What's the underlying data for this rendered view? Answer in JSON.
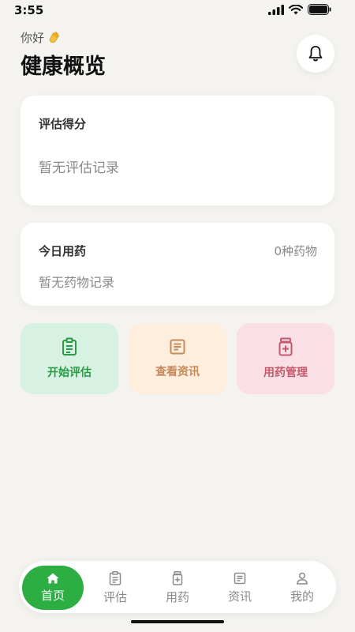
{
  "status_bar": {
    "time": "3:55"
  },
  "header": {
    "greeting": "你好",
    "title": "健康概览"
  },
  "score_card": {
    "title": "评估得分",
    "empty_text": "暂无评估记录"
  },
  "med_card": {
    "title": "今日用药",
    "count": "0种药物",
    "empty_text": "暂无药物记录"
  },
  "actions": [
    {
      "label": "开始评估",
      "icon": "clipboard-icon",
      "color": "#2a9a44"
    },
    {
      "label": "查看资讯",
      "icon": "document-icon",
      "color": "#c48a5c"
    },
    {
      "label": "用药管理",
      "icon": "medicine-bottle-icon",
      "color": "#c35a6e"
    }
  ],
  "nav": {
    "items": [
      {
        "label": "首页",
        "icon": "home-icon",
        "active": true
      },
      {
        "label": "评估",
        "icon": "clipboard-icon",
        "active": false
      },
      {
        "label": "用药",
        "icon": "medicine-bottle-icon",
        "active": false
      },
      {
        "label": "资讯",
        "icon": "document-icon",
        "active": false
      },
      {
        "label": "我的",
        "icon": "user-icon",
        "active": false
      }
    ]
  },
  "colors": {
    "accent": "#2cae43",
    "background": "#f4f3ef"
  }
}
